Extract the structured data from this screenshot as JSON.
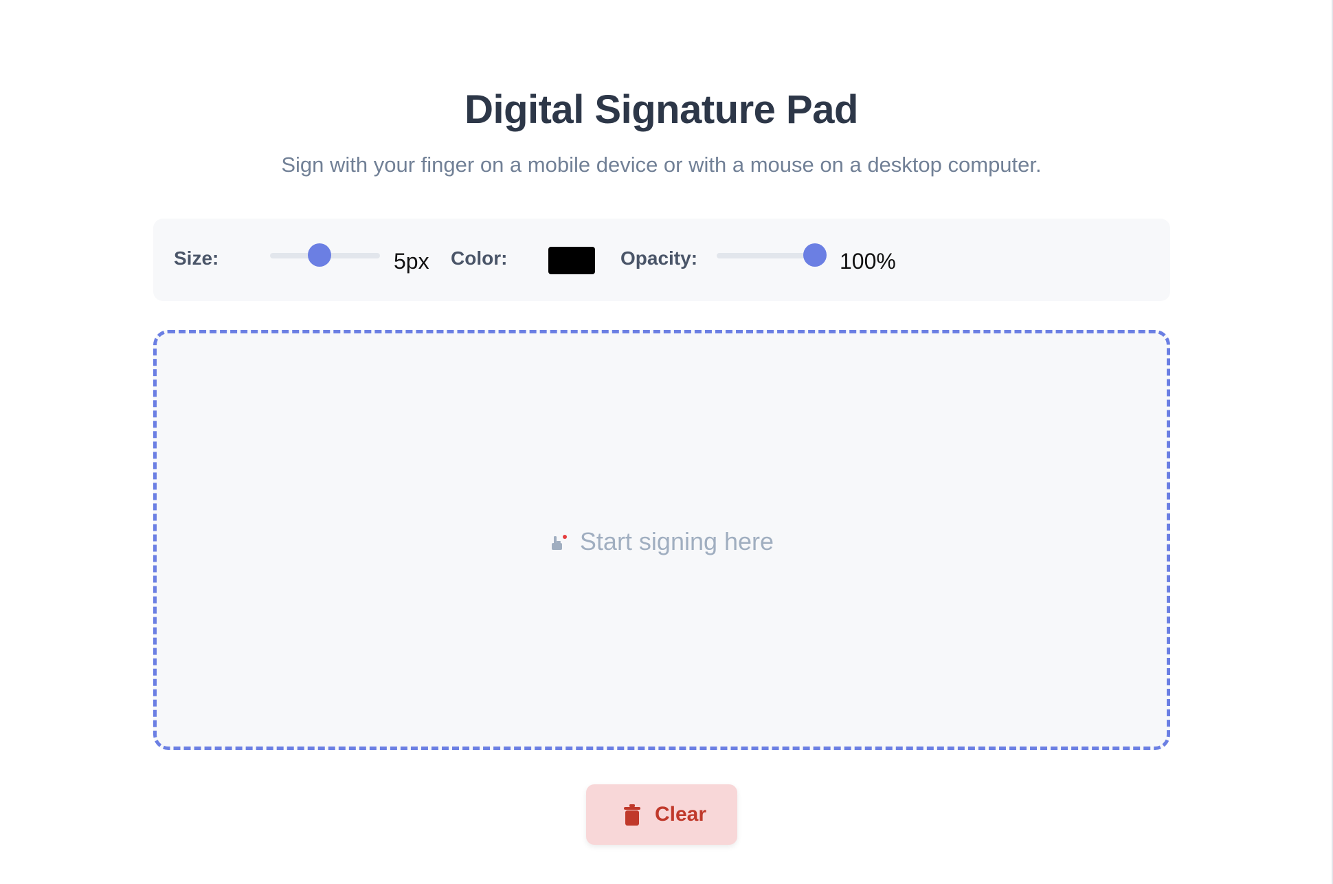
{
  "header": {
    "title": "Digital Signature Pad",
    "subtitle": "Sign with your finger on a mobile device or with a mouse on a desktop computer."
  },
  "toolbar": {
    "size_label": "Size:",
    "size_value": "5px",
    "size_fraction": 0.45,
    "color_label": "Color:",
    "color_value": "#000000",
    "opacity_label": "Opacity:",
    "opacity_value": "100%",
    "opacity_fraction": 1.0
  },
  "pad": {
    "placeholder": "Start signing here",
    "placeholder_icon": "signature-hand-icon"
  },
  "actions": {
    "clear_label": "Clear",
    "clear_icon": "trash-icon"
  },
  "colors": {
    "accent": "#6b7fe3",
    "title": "#2d3748",
    "subtitle": "#718096",
    "danger": "#c0392b",
    "danger_bg": "#f8d7d8"
  }
}
